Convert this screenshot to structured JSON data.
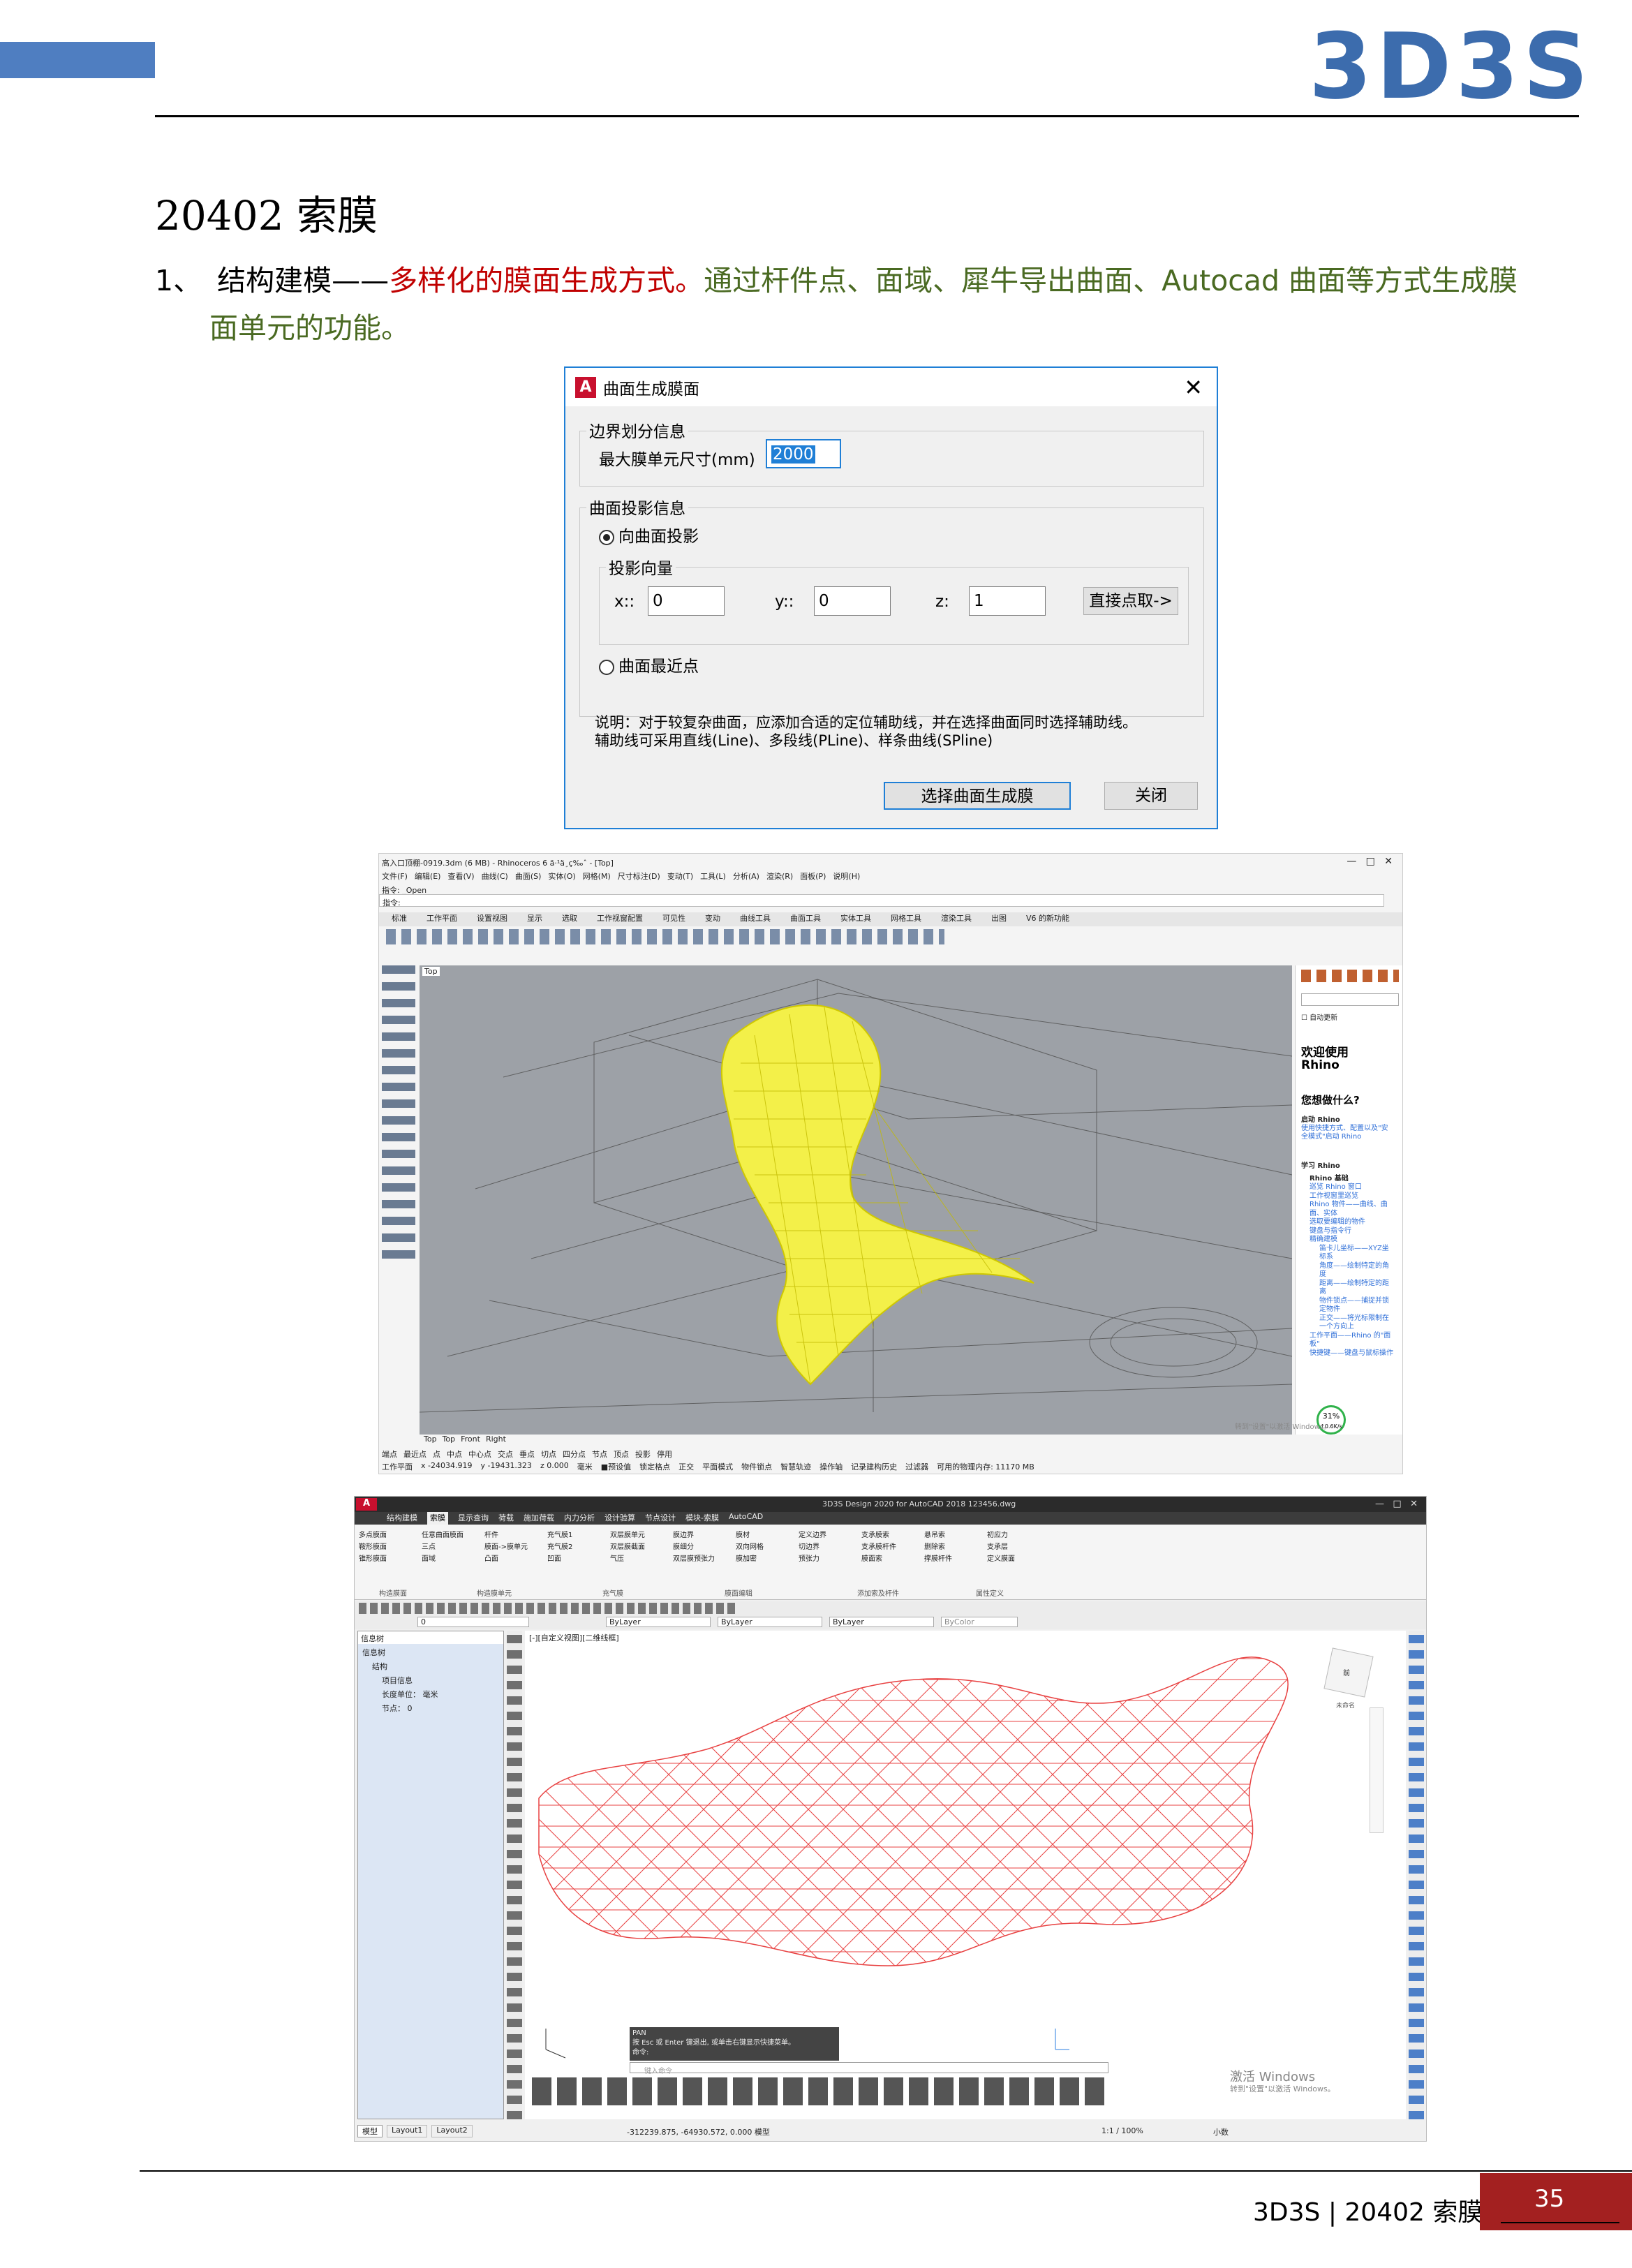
{
  "header": {
    "logo": "3D3S"
  },
  "section": {
    "title": "20402  索膜",
    "item_number": "1、",
    "item_lead": "结构建模——",
    "item_highlight": "多样化的膜面生成方式。",
    "item_rest": "通过杆件点、面域、犀牛导出曲面、Autocad 曲面等方式生成膜",
    "item_line2": "面单元的功能。"
  },
  "dialog": {
    "title": "曲面生成膜面",
    "close": "✕",
    "group1_label": "边界划分信息",
    "max_size_label": "最大膜单元尺寸(mm)",
    "max_size_value": "2000",
    "group2_label": "曲面投影信息",
    "radio_project": "向曲面投影",
    "proj_dir_label": "投影向量",
    "x_label": "x::",
    "x_value": "0",
    "y_label": "y::",
    "y_value": "0",
    "z_label": "z:",
    "z_value": "1",
    "pick_button": "直接点取->",
    "radio_nearest": "曲面最近点",
    "note_line1": "说明：对于较复杂曲面，应添加合适的定位辅助线，并在选择曲面同时选择辅助线。",
    "note_line2": "辅助线可采用直线(Line)、多段线(PLine)、样条曲线(SPline)",
    "select_button": "选择曲面生成膜",
    "close_button": "关闭"
  },
  "rhino": {
    "window_title": "高入口顶棚-0919.3dm (6 MB) - Rhinoceros 6 ä·¹ä¸ç‰ˆ - [Top]",
    "menu": [
      "文件(F)",
      "编辑(E)",
      "查看(V)",
      "曲线(C)",
      "曲面(S)",
      "实体(O)",
      "网格(M)",
      "尺寸标注(D)",
      "变动(T)",
      "工具(L)",
      "分析(A)",
      "渲染(R)",
      "面板(P)",
      "说明(H)"
    ],
    "command_prev": "指令: _Open",
    "command_prompt": "指令:",
    "tabs": [
      "标准",
      "工作平面",
      "设置视图",
      "显示",
      "选取",
      "工作视窗配置",
      "可见性",
      "变动",
      "曲线工具",
      "曲面工具",
      "实体工具",
      "网格工具",
      "渲染工具",
      "出图",
      "V6 的新功能"
    ],
    "viewport_label": "Top",
    "viewport_tabs": [
      "Top",
      "Top",
      "Front",
      "Right"
    ],
    "panel": {
      "auto_update": "自动更新",
      "welcome": "欢迎使用 Rhino",
      "question": "您想做什么?",
      "start": "启动 Rhino",
      "start_desc": "使用快捷方式、配置以及\"安全模式\"启动 Rhino",
      "learn": "学习 Rhino",
      "basics": "Rhino 基础",
      "links": [
        "巡览 Rhino 窗口",
        "工作视窗里巡览",
        "Rhino 物件——曲线、曲面、实体",
        "选取要编辑的物件",
        "键盘与指令行",
        "精确建模",
        "笛卡儿坐标——XYZ坐标系",
        "角度——绘制特定的角度",
        "距离——绘制特定的距离",
        "物件锁点——捕捉并锁定物件",
        "正交——将光标限制在一个方向上",
        "工作平面——Rhino 的\"面板\"",
        "快捷键——键盘与鼠标操作"
      ],
      "zoom": "31%",
      "speed": "↑0.6K/s"
    },
    "snaps": [
      "端点",
      "最近点",
      "点",
      "中点",
      "中心点",
      "交点",
      "垂点",
      "切点",
      "四分点",
      "节点",
      "顶点",
      "投影",
      "停用"
    ],
    "status": [
      "工作平面",
      "x -24034.919",
      "y -19431.323",
      "z 0.000",
      "毫米",
      "■预设值",
      "锁定格点",
      "正交",
      "平面模式",
      "物件锁点",
      "智慧轨迹",
      "操作轴",
      "记录建构历史",
      "过滤器",
      "可用的物理内存: 11170 MB"
    ],
    "activate": "激活 Windows",
    "activate_sub": "转到\"设置\"以激活 Windows。"
  },
  "acad": {
    "window_title": "3D3S Design 2020 for AutoCAD 2018   123456.dwg",
    "ribbon_tabs": [
      "结构建模",
      "索膜",
      "显示查询",
      "荷载",
      "施加荷载",
      "内力分析",
      "设计验算",
      "节点设计",
      "模块-索膜",
      "AutoCAD"
    ],
    "ribbon_groups": [
      "构造膜面",
      "构造膜单元",
      "充气膜",
      "膜面编辑",
      "添加索及杆件",
      "属性定义"
    ],
    "ribbon_items": [
      "多点膜面",
      "鞍形膜面",
      "锥形膜面",
      "任意曲面膜面",
      "杆件",
      "三点",
      "面域",
      "膜面->膜单元",
      "充气膜1",
      "充气膜2",
      "凸面",
      "凹面",
      "气压",
      "双层膜单元",
      "双层膜截面",
      "双层膜预张力",
      "膜边界",
      "膜细分",
      "膜加密",
      "膜材",
      "双向网格",
      "预张力",
      "定义边界",
      "切边界",
      "膜面索",
      "支承膜索",
      "支承膜杆件",
      "撑膜杆件",
      "悬吊索",
      "删除索",
      "定义膜面",
      "初应力",
      "支承层"
    ],
    "layer": "0",
    "bylayer1": "ByLayer",
    "bylayer2": "ByLayer",
    "bylayer3": "ByLayer",
    "bycolor": "ByColor",
    "tree_title": "信息树",
    "tree": [
      "信息树",
      "结构",
      "项目信息",
      "长度单位： 毫米",
      "节点： 0"
    ],
    "viewport_label": "[-][自定义视图][二维线框]",
    "cmd_history1": "PAN",
    "cmd_history2": "按 Esc 或 Enter 键退出, 或单击右键显示快捷菜单。",
    "cmd_history3": "命令:",
    "cmd_input": "键入命令",
    "activate": "激活 Windows",
    "activate_sub": "转到\"设置\"以激活 Windows。",
    "layout_tabs": [
      "模型",
      "Layout1",
      "Layout2"
    ],
    "coords": "-312239.875, -64930.572, 0.000  模型",
    "scale": "1:1 / 100%",
    "units": "小数",
    "viewcube": "前",
    "unnamed": "未命名"
  },
  "footer": {
    "text": "3D3S | 20402  索膜",
    "page": "35"
  }
}
